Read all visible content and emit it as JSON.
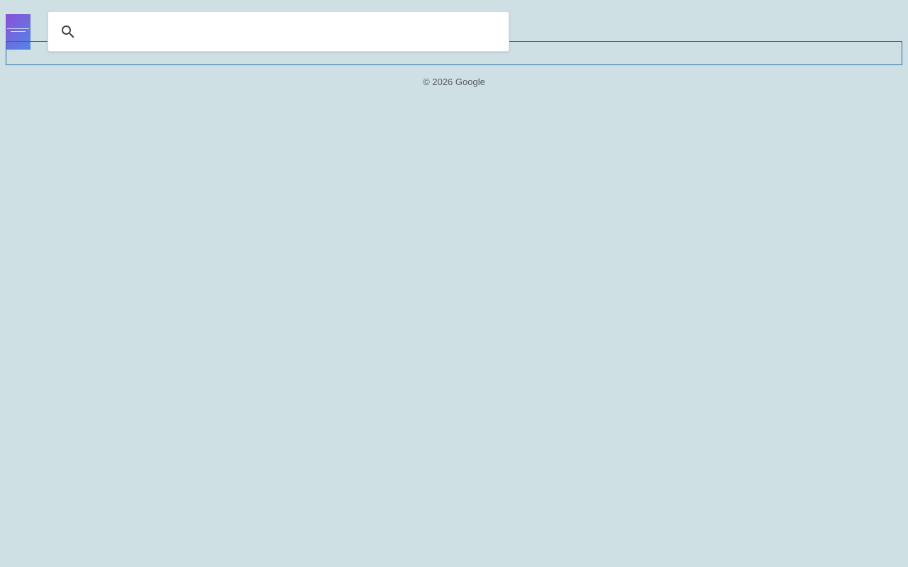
{
  "header": {
    "search": {
      "value": "",
      "placeholder": ""
    }
  },
  "icons": {
    "search": "search-icon",
    "thumbnail": "book-cover-thumbnail"
  },
  "colors": {
    "background": "#cfe0e4",
    "frame_border": "#1f6fa8",
    "thumbnail_start": "#8a4fd8",
    "thumbnail_end": "#4f86e8"
  },
  "footer": {
    "copyright": "© 2026 Google"
  }
}
